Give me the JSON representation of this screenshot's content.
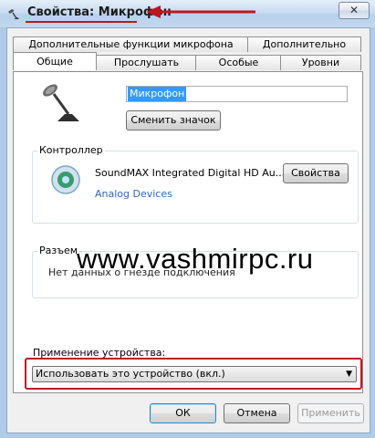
{
  "window": {
    "title": "Свойства: Микрофон",
    "close_label": "✕"
  },
  "tabs_row1": [
    {
      "label": "Дополнительные функции микрофона"
    },
    {
      "label": "Дополнительно"
    }
  ],
  "tabs_row2": [
    {
      "label": "Общие",
      "active": true
    },
    {
      "label": "Прослушать"
    },
    {
      "label": "Особые"
    },
    {
      "label": "Уровни"
    }
  ],
  "general": {
    "device_name": "Микрофон",
    "change_icon_label": "Сменить значок"
  },
  "controller": {
    "label": "Контроллер",
    "device": "SoundMAX Integrated Digital HD Au...",
    "vendor": "Analog Devices",
    "properties_label": "Свойства"
  },
  "jack": {
    "label": "Разъем",
    "info": "Нет данных о гнезде подключения"
  },
  "watermark": "www.vashmirpc.ru",
  "usage": {
    "label": "Применение устройства:",
    "selected": "Использовать это устройство (вкл.)"
  },
  "footer": {
    "ok_label": "ОК",
    "cancel_label": "Отмена",
    "apply_label": "Применить"
  },
  "colors": {
    "highlight": "#c0161d",
    "link": "#2a6ab8"
  }
}
